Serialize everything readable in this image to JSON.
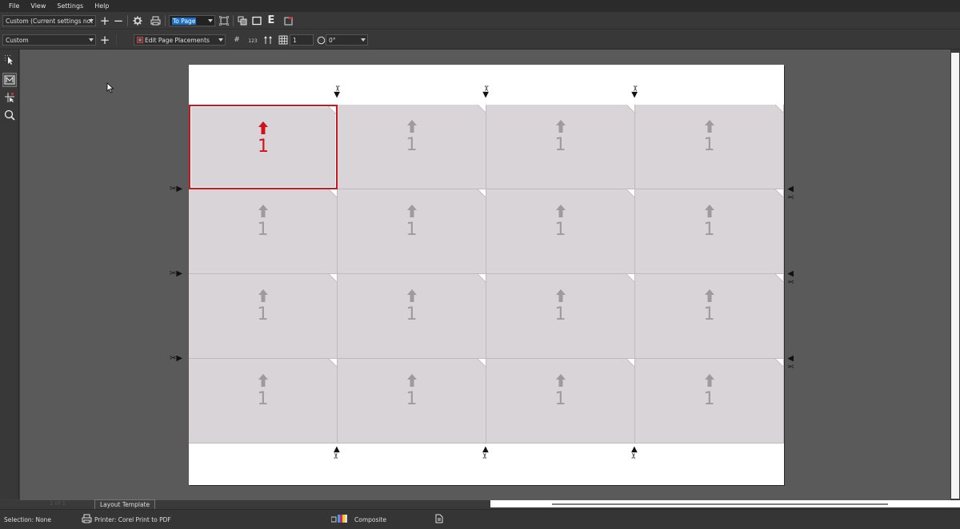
{
  "menubar": {
    "items": [
      "File",
      "View",
      "Settings",
      "Help"
    ]
  },
  "toolbar1": {
    "preset_value": "Custom (Current settings not ...",
    "fit_value": "To Page"
  },
  "toolbar2": {
    "layout_value": "Custom",
    "placement_value": "Edit Page Placements",
    "number_value": "1",
    "rotation_value": "0°"
  },
  "page": {
    "cell_number": "1",
    "rows": 4,
    "columns": 4,
    "selected_cell": "row 1, column 1",
    "colors": {
      "cell": "#d8d4d8",
      "selected_border": "#c8191e",
      "selected_arrow": "#d0121a",
      "arrow": "#9e9a9e"
    }
  },
  "tabs": {
    "page_nav": "1 of 1",
    "layout_tab": "Layout Template"
  },
  "status": {
    "selection": "Selection: None",
    "printer": "Printer: Corel Print to PDF",
    "mode": "Composite"
  },
  "icons": [
    "plus-icon",
    "minus-icon",
    "gear-icon",
    "printer-icon",
    "fit-page-icon",
    "tile-icon",
    "rectangle-icon",
    "e-icon",
    "pages-icon",
    "add-icon",
    "layout-icon",
    "numbering-icon",
    "grid-icon",
    "rotate-icon",
    "pick-tool-icon",
    "imposition-tool-icon",
    "gutter-tool-icon",
    "zoom-tool-icon",
    "scissors-icon",
    "color-bars-icon",
    "document-icon"
  ]
}
